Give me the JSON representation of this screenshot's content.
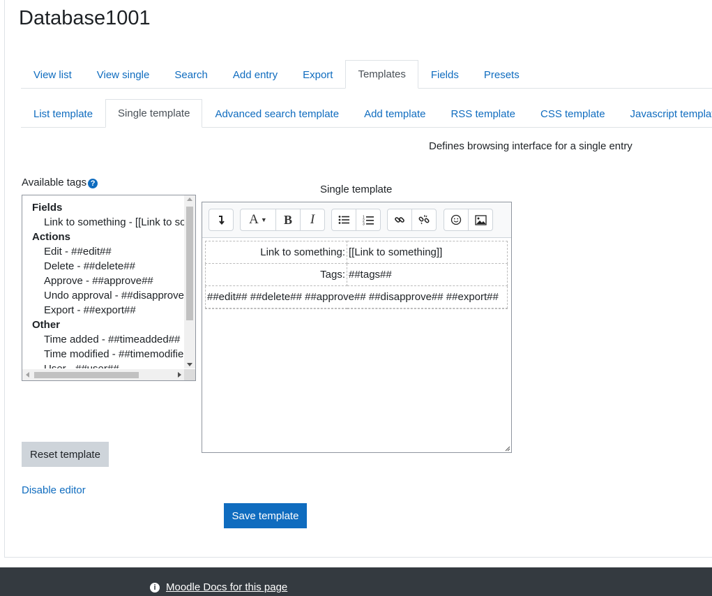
{
  "page_title": "Database1001",
  "main_tabs": [
    "View list",
    "View single",
    "Search",
    "Add entry",
    "Export",
    "Templates",
    "Fields",
    "Presets"
  ],
  "main_tabs_active": "Templates",
  "template_tabs": [
    "List template",
    "Single template",
    "Advanced search template",
    "Add template",
    "RSS template",
    "CSS template",
    "Javascript template"
  ],
  "template_tabs_active": "Single template",
  "description": "Defines browsing interface for a single entry",
  "available_tags": {
    "label": "Available tags",
    "help_icon": "question-circle-icon",
    "groups": [
      {
        "name": "Fields",
        "items": [
          "Link to something - [[Link to something]]"
        ]
      },
      {
        "name": "Actions",
        "items": [
          "Edit - ##edit##",
          "Delete - ##delete##",
          "Approve - ##approve##",
          "Undo approval - ##disapprove##",
          "Export - ##export##"
        ]
      },
      {
        "name": "Other",
        "items": [
          "Time added - ##timeadded##",
          "Time modified - ##timemodified##",
          "User - ##user##"
        ]
      }
    ]
  },
  "editor": {
    "label": "Single template",
    "toolbar_icons": [
      "collapse-toolbar-icon",
      "font-style-icon",
      "bold-icon",
      "italic-icon",
      "unordered-list-icon",
      "ordered-list-icon",
      "link-icon",
      "unlink-icon",
      "emoji-icon",
      "image-icon"
    ],
    "rows": [
      {
        "label": "Link to something:",
        "value": "[[Link to something]]"
      },
      {
        "label": "Tags:",
        "value": "##tags##"
      }
    ],
    "actions_row": "##edit## ##delete## ##approve## ##disapprove## ##export##"
  },
  "buttons": {
    "reset": "Reset template",
    "disable_editor": "Disable editor",
    "save": "Save template"
  },
  "footer": {
    "docs_link": "Moodle Docs for this page",
    "icon": "info-circle-icon"
  },
  "colors": {
    "link": "#0f6cbf",
    "primary_button": "#0f6cbf",
    "secondary_button": "#ced4da",
    "footer_bg": "#343a40"
  }
}
